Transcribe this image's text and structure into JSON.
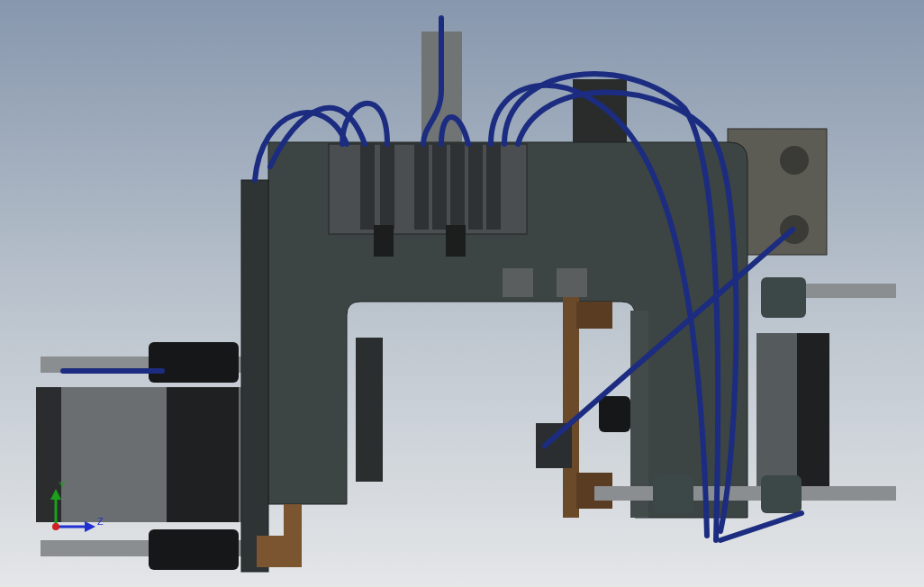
{
  "viewport": {
    "triad": {
      "axes": [
        {
          "kind": "vertical",
          "label": "Y"
        },
        {
          "kind": "horizontal",
          "label": "Z"
        }
      ]
    }
  }
}
